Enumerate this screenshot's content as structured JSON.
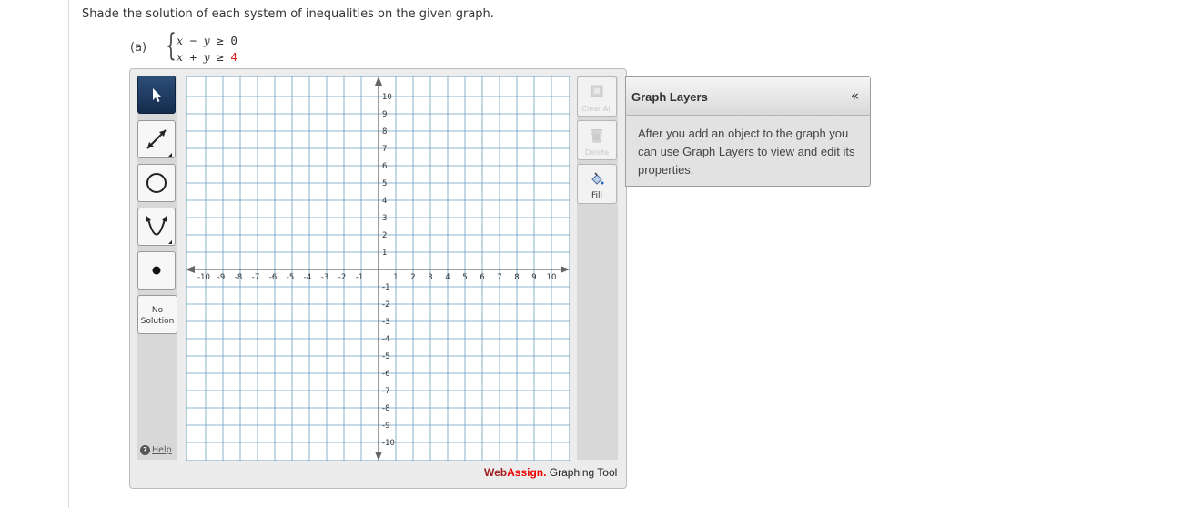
{
  "instruction": "Shade the solution of each system of inequalities on the given graph.",
  "part_label": "(a)",
  "inequalities": [
    {
      "lhs_a": "x",
      "op": "−",
      "lhs_b": "y",
      "rel": "≥",
      "rhs": "0",
      "rhs_color": "#333333"
    },
    {
      "lhs_a": "x",
      "op": "+",
      "lhs_b": "y",
      "rel": "≥",
      "rhs": "4",
      "rhs_color": "#dd2222"
    }
  ],
  "tools": [
    {
      "name": "select-tool",
      "icon": "pointer-arrow-icon",
      "active": true
    },
    {
      "name": "line-tool",
      "icon": "line-icon",
      "active": false
    },
    {
      "name": "circle-tool",
      "icon": "circle-icon",
      "active": false
    },
    {
      "name": "parabola-tool",
      "icon": "parabola-icon",
      "active": false
    },
    {
      "name": "point-tool",
      "icon": "point-icon",
      "active": false
    }
  ],
  "no_solution_label_1": "No",
  "no_solution_label_2": "Solution",
  "help_label": "Help",
  "actions": {
    "clear_all": "Clear All",
    "delete": "Delete",
    "fill": "Fill"
  },
  "graph": {
    "x_min": -10,
    "x_max": 10,
    "y_min": -10,
    "y_max": 10,
    "x_ticks": [
      "-10",
      "-9",
      "-8",
      "-7",
      "-6",
      "-5",
      "-4",
      "-3",
      "-2",
      "-1",
      "1",
      "2",
      "3",
      "4",
      "5",
      "6",
      "7",
      "8",
      "9",
      "10"
    ],
    "y_ticks": [
      "10",
      "9",
      "8",
      "7",
      "6",
      "5",
      "4",
      "3",
      "2",
      "1",
      "-1",
      "-2",
      "-3",
      "-4",
      "-5",
      "-6",
      "-7",
      "-8",
      "-9",
      "-10"
    ],
    "grid_color": "#6a9dbf",
    "axis_color": "#666666"
  },
  "branding": {
    "web": "Web",
    "assign": "Assign.",
    "tool": " Graphing Tool"
  },
  "layers": {
    "title": "Graph Layers",
    "collapse": "«",
    "body": "After you add an object to the graph you can use Graph Layers to view and edit its properties."
  }
}
